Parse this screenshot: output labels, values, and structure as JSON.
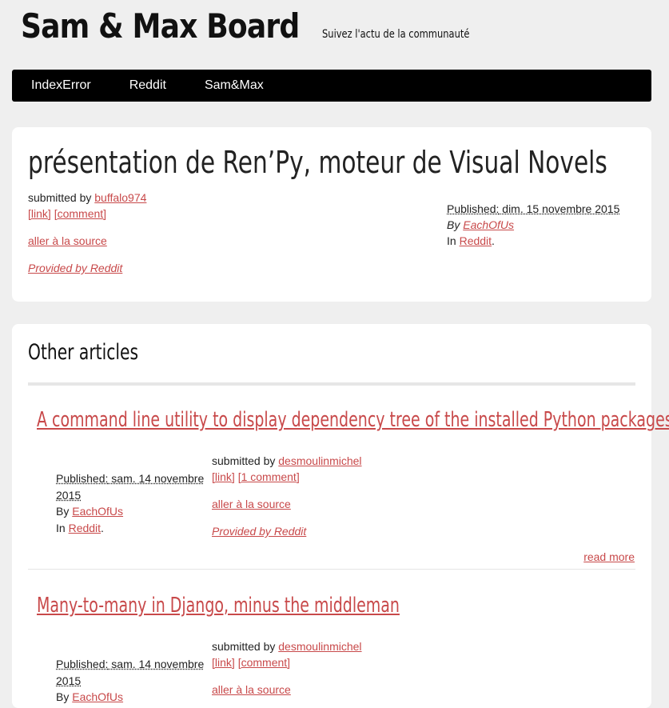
{
  "site": {
    "title": "Sam & Max Board",
    "tagline": "Suivez l'actu de la communauté"
  },
  "nav": {
    "items": [
      {
        "label": "IndexError"
      },
      {
        "label": "Reddit"
      },
      {
        "label": "Sam&Max"
      }
    ]
  },
  "post": {
    "title": "présentation de Ren’Py, moteur de Visual Novels",
    "submitted_by_label": "submitted by",
    "author": "buffalo974",
    "link_label": "[link]",
    "comment_label": "[comment]",
    "source_label": "aller à la source",
    "provided_by": "Provided by Reddit",
    "published_label": "Published:",
    "published_date": "dim. 15 novembre 2015",
    "by_label": "By",
    "by_author": "EachOfUs",
    "in_label": "In",
    "in_category": "Reddit",
    "period": "."
  },
  "other": {
    "title": "Other articles",
    "read_more": "read more",
    "articles": [
      {
        "title": "A command line utility to display dependency tree of the installed Python packages",
        "published_label": "Published:",
        "published_date": "sam. 14 novembre 2015",
        "by_label": "By",
        "by_author": "EachOfUs",
        "in_label": "In",
        "in_category": "Reddit",
        "period": ".",
        "submitted_by_label": "submitted by",
        "author": "desmoulinmichel",
        "link_label": "[link]",
        "comment_label": "[1 comment]",
        "source_label": "aller à la source",
        "provided_by": "Provided by Reddit"
      },
      {
        "title": "Many-to-many in Django, minus the middleman",
        "published_label": "Published:",
        "published_date": "sam. 14 novembre 2015",
        "by_label": "By",
        "by_author": "EachOfUs",
        "submitted_by_label": "submitted by",
        "author": "desmoulinmichel",
        "link_label": "[link]",
        "comment_label": "[comment]",
        "source_label": "aller à la source"
      }
    ]
  }
}
